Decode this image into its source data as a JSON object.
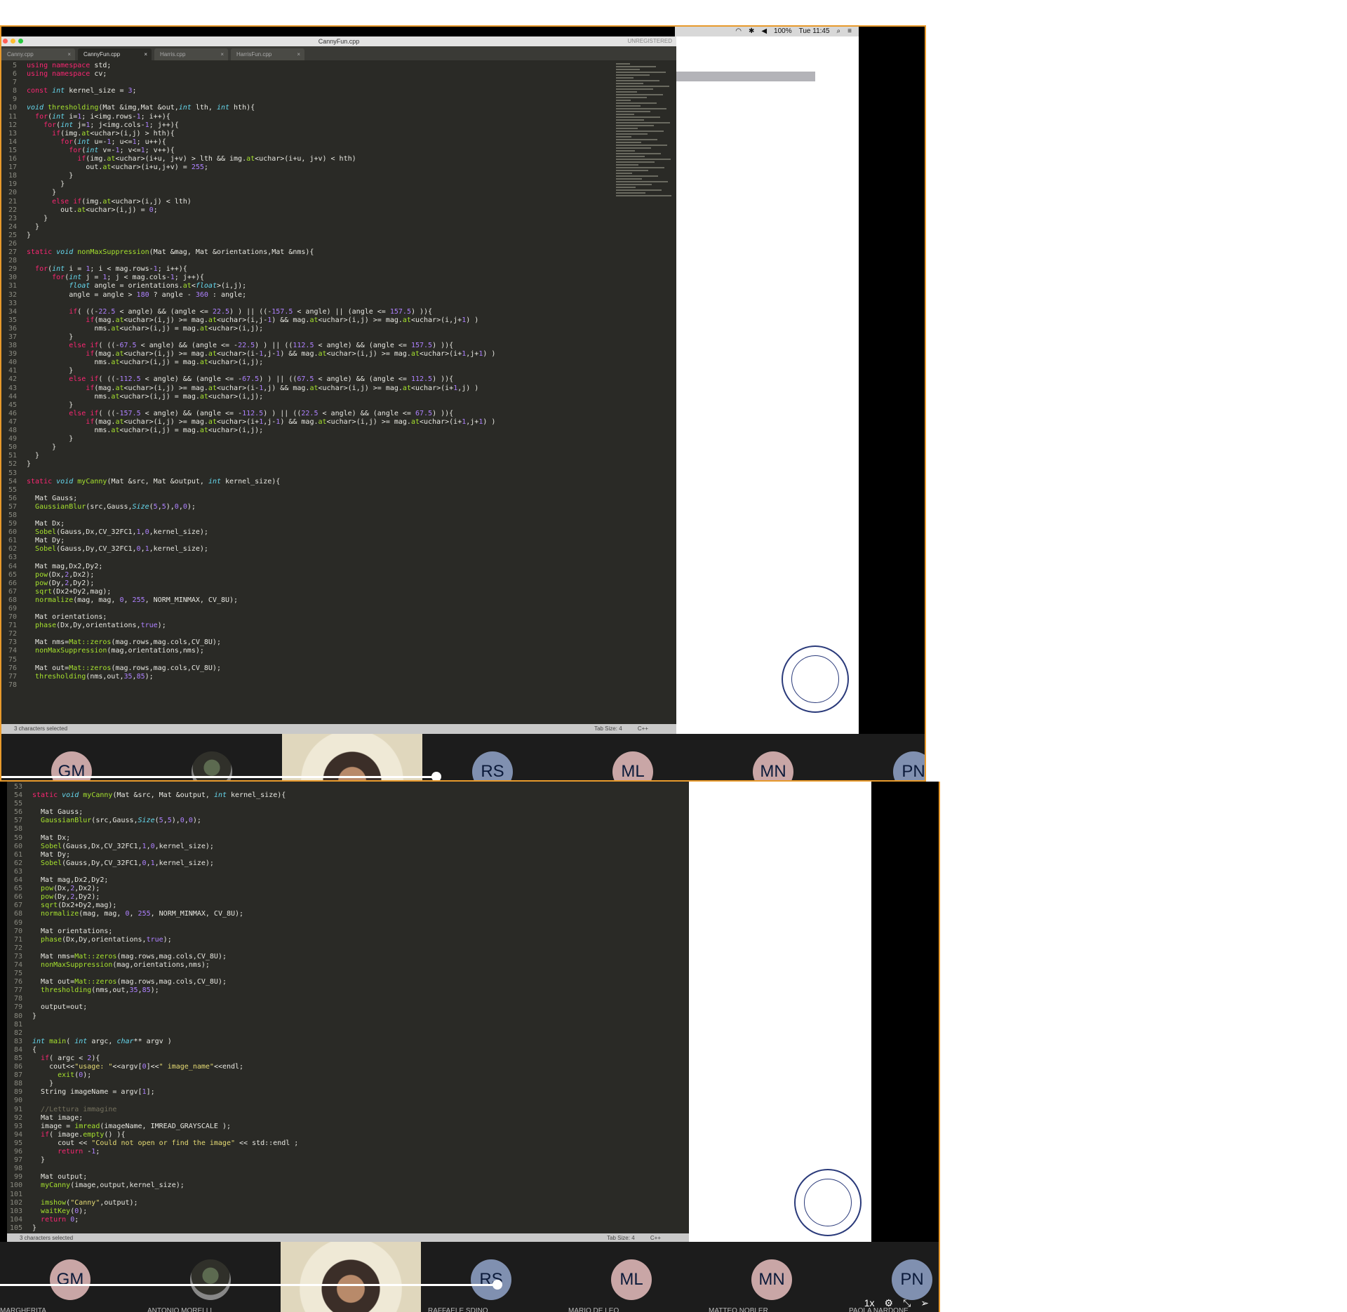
{
  "menubar": {
    "battery": "100%",
    "clock": "Tue 11:45"
  },
  "editor1": {
    "window_title": "CannyFun.cpp",
    "unregistered": "UNREGISTERED",
    "tabs": [
      {
        "label": "Canny.cpp",
        "active": false
      },
      {
        "label": "CannyFun.cpp",
        "active": true
      },
      {
        "label": "Harris.cpp",
        "active": false
      },
      {
        "label": "HarrisFun.cpp",
        "active": false
      }
    ],
    "status_left": "3 characters selected",
    "status_tab": "Tab Size: 4",
    "status_lang": "C++",
    "lines": [
      {
        "n": "5",
        "c": "<span class='kw'>using namespace</span> std;"
      },
      {
        "n": "6",
        "c": "<span class='kw'>using namespace</span> cv;"
      },
      {
        "n": "7",
        "c": ""
      },
      {
        "n": "8",
        "c": "<span class='kw'>const</span> <span class='ty'>int</span> kernel_size = <span class='nu'>3</span>;"
      },
      {
        "n": "9",
        "c": ""
      },
      {
        "n": "10",
        "c": "<span class='ty'>void</span> <span class='fn'>thresholding</span>(Mat &amp;img,Mat &amp;out,<span class='ty'>int</span> lth, <span class='ty'>int</span> hth){"
      },
      {
        "n": "11",
        "c": "  <span class='kw'>for</span>(<span class='ty'>int</span> i=<span class='nu'>1</span>; i&lt;img.rows-<span class='nu'>1</span>; i++){"
      },
      {
        "n": "12",
        "c": "    <span class='kw'>for</span>(<span class='ty'>int</span> j=<span class='nu'>1</span>; j&lt;img.cols-<span class='nu'>1</span>; j++){"
      },
      {
        "n": "13",
        "c": "      <span class='kw'>if</span>(img.<span class='fn'>at</span>&lt;uchar&gt;(i,j) &gt; hth){"
      },
      {
        "n": "14",
        "c": "        <span class='kw'>for</span>(<span class='ty'>int</span> u=-<span class='nu'>1</span>; u&lt;=<span class='nu'>1</span>; u++){"
      },
      {
        "n": "15",
        "c": "          <span class='kw'>for</span>(<span class='ty'>int</span> v=-<span class='nu'>1</span>; v&lt;=<span class='nu'>1</span>; v++){"
      },
      {
        "n": "16",
        "c": "            <span class='kw'>if</span>(img.<span class='fn'>at</span>&lt;uchar&gt;(i+u, j+v) &gt; lth &amp;&amp; img.<span class='fn'>at</span>&lt;uchar&gt;(i+u, j+v) &lt; hth)"
      },
      {
        "n": "17",
        "c": "              out.<span class='fn'>at</span>&lt;uchar&gt;(i+u,j+v) = <span class='nu'>255</span>;"
      },
      {
        "n": "18",
        "c": "          }"
      },
      {
        "n": "19",
        "c": "        }"
      },
      {
        "n": "20",
        "c": "      }"
      },
      {
        "n": "21",
        "c": "      <span class='kw'>else if</span>(img.<span class='fn'>at</span>&lt;uchar&gt;(i,j) &lt; lth)"
      },
      {
        "n": "22",
        "c": "        out.<span class='fn'>at</span>&lt;uchar&gt;(i,j) = <span class='nu'>0</span>;"
      },
      {
        "n": "23",
        "c": "    }"
      },
      {
        "n": "24",
        "c": "  }"
      },
      {
        "n": "25",
        "c": "}"
      },
      {
        "n": "26",
        "c": ""
      },
      {
        "n": "27",
        "c": "<span class='kw'>static</span> <span class='ty'>void</span> <span class='fn'>nonMaxSuppression</span>(Mat &amp;mag, Mat &amp;orientations,Mat &amp;nms){"
      },
      {
        "n": "28",
        "c": ""
      },
      {
        "n": "29",
        "c": "  <span class='kw'>for</span>(<span class='ty'>int</span> i = <span class='nu'>1</span>; i &lt; mag.rows-<span class='nu'>1</span>; i++){"
      },
      {
        "n": "30",
        "c": "      <span class='kw'>for</span>(<span class='ty'>int</span> j = <span class='nu'>1</span>; j &lt; mag.cols-<span class='nu'>1</span>; j++){"
      },
      {
        "n": "31",
        "c": "          <span class='ty'>float</span> angle = orientations.<span class='fn'>at</span>&lt;<span class='ty'>float</span>&gt;(i,j);"
      },
      {
        "n": "32",
        "c": "          angle = angle &gt; <span class='nu'>180</span> ? angle - <span class='nu'>360</span> : angle;"
      },
      {
        "n": "33",
        "c": ""
      },
      {
        "n": "34",
        "c": "          <span class='kw'>if</span>( ((-<span class='nu'>22.5</span> &lt; angle) &amp;&amp; (angle &lt;= <span class='nu'>22.5</span>) ) || ((-<span class='nu'>157.5</span> &lt; angle) || (angle &lt;= <span class='nu'>157.5</span>) )){"
      },
      {
        "n": "35",
        "c": "              <span class='kw'>if</span>(mag.<span class='fn'>at</span>&lt;uchar&gt;(i,j) &gt;= mag.<span class='fn'>at</span>&lt;uchar&gt;(i,j-<span class='nu'>1</span>) &amp;&amp; mag.<span class='fn'>at</span>&lt;uchar&gt;(i,j) &gt;= mag.<span class='fn'>at</span>&lt;uchar&gt;(i,j+<span class='nu'>1</span>) )"
      },
      {
        "n": "36",
        "c": "                nms.<span class='fn'>at</span>&lt;uchar&gt;(i,j) = mag.<span class='fn'>at</span>&lt;uchar&gt;(i,j);"
      },
      {
        "n": "37",
        "c": "          }"
      },
      {
        "n": "38",
        "c": "          <span class='kw'>else if</span>( ((-<span class='nu'>67.5</span> &lt; angle) &amp;&amp; (angle &lt;= -<span class='nu'>22.5</span>) ) || ((<span class='nu'>112.5</span> &lt; angle) &amp;&amp; (angle &lt;= <span class='nu'>157.5</span>) )){"
      },
      {
        "n": "39",
        "c": "              <span class='kw'>if</span>(mag.<span class='fn'>at</span>&lt;uchar&gt;(i,j) &gt;= mag.<span class='fn'>at</span>&lt;uchar&gt;(i-<span class='nu'>1</span>,j-<span class='nu'>1</span>) &amp;&amp; mag.<span class='fn'>at</span>&lt;uchar&gt;(i,j) &gt;= mag.<span class='fn'>at</span>&lt;uchar&gt;(i+<span class='nu'>1</span>,j+<span class='nu'>1</span>) )"
      },
      {
        "n": "40",
        "c": "                nms.<span class='fn'>at</span>&lt;uchar&gt;(i,j) = mag.<span class='fn'>at</span>&lt;uchar&gt;(i,j);"
      },
      {
        "n": "41",
        "c": "          }"
      },
      {
        "n": "42",
        "c": "          <span class='kw'>else if</span>( ((-<span class='nu'>112.5</span> &lt; angle) &amp;&amp; (angle &lt;= -<span class='nu'>67.5</span>) ) || ((<span class='nu'>67.5</span> &lt; angle) &amp;&amp; (angle &lt;= <span class='nu'>112.5</span>) )){"
      },
      {
        "n": "43",
        "c": "              <span class='kw'>if</span>(mag.<span class='fn'>at</span>&lt;uchar&gt;(i,j) &gt;= mag.<span class='fn'>at</span>&lt;uchar&gt;(i-<span class='nu'>1</span>,j) &amp;&amp; mag.<span class='fn'>at</span>&lt;uchar&gt;(i,j) &gt;= mag.<span class='fn'>at</span>&lt;uchar&gt;(i+<span class='nu'>1</span>,j) )"
      },
      {
        "n": "44",
        "c": "                nms.<span class='fn'>at</span>&lt;uchar&gt;(i,j) = mag.<span class='fn'>at</span>&lt;uchar&gt;(i,j);"
      },
      {
        "n": "45",
        "c": "          }"
      },
      {
        "n": "46",
        "c": "          <span class='kw'>else if</span>( ((-<span class='nu'>157.5</span> &lt; angle) &amp;&amp; (angle &lt;= -<span class='nu'>112.5</span>) ) || ((<span class='nu'>22.5</span> &lt; angle) &amp;&amp; (angle &lt;= <span class='nu'>67.5</span>) )){"
      },
      {
        "n": "47",
        "c": "              <span class='kw'>if</span>(mag.<span class='fn'>at</span>&lt;uchar&gt;(i,j) &gt;= mag.<span class='fn'>at</span>&lt;uchar&gt;(i+<span class='nu'>1</span>,j-<span class='nu'>1</span>) &amp;&amp; mag.<span class='fn'>at</span>&lt;uchar&gt;(i,j) &gt;= mag.<span class='fn'>at</span>&lt;uchar&gt;(i+<span class='nu'>1</span>,j+<span class='nu'>1</span>) )"
      },
      {
        "n": "48",
        "c": "                nms.<span class='fn'>at</span>&lt;uchar&gt;(i,j) = mag.<span class='fn'>at</span>&lt;uchar&gt;(i,j);"
      },
      {
        "n": "49",
        "c": "          }"
      },
      {
        "n": "50",
        "c": "      }"
      },
      {
        "n": "51",
        "c": "  }"
      },
      {
        "n": "52",
        "c": "}"
      },
      {
        "n": "53",
        "c": ""
      },
      {
        "n": "54",
        "c": "<span class='kw'>static</span> <span class='ty'>void</span> <span class='fn'>myCanny</span>(Mat &amp;src, Mat &amp;output, <span class='ty'>int</span> kernel_size){"
      },
      {
        "n": "55",
        "c": ""
      },
      {
        "n": "56",
        "c": "  Mat Gauss;"
      },
      {
        "n": "57",
        "c": "  <span class='fn'>GaussianBlur</span>(src,Gauss,<span class='ty'>Size</span>(<span class='nu'>5</span>,<span class='nu'>5</span>),<span class='nu'>0</span>,<span class='nu'>0</span>);"
      },
      {
        "n": "58",
        "c": ""
      },
      {
        "n": "59",
        "c": "  Mat Dx;"
      },
      {
        "n": "60",
        "c": "  <span class='fn'>Sobel</span>(Gauss,Dx,CV_32FC1,<span class='nu'>1</span>,<span class='nu'>0</span>,kernel_size);"
      },
      {
        "n": "61",
        "c": "  Mat Dy;"
      },
      {
        "n": "62",
        "c": "  <span class='fn'>Sobel</span>(Gauss,Dy,CV_32FC1,<span class='nu'>0</span>,<span class='nu'>1</span>,kernel_size);"
      },
      {
        "n": "63",
        "c": ""
      },
      {
        "n": "64",
        "c": "  Mat mag,Dx2,Dy2;"
      },
      {
        "n": "65",
        "c": "  <span class='fn'>pow</span>(Dx,<span class='nu'>2</span>,Dx2);"
      },
      {
        "n": "66",
        "c": "  <span class='fn'>pow</span>(Dy,<span class='nu'>2</span>,Dy2);"
      },
      {
        "n": "67",
        "c": "  <span class='fn'>sqrt</span>(Dx2+Dy2,mag);"
      },
      {
        "n": "68",
        "c": "  <span class='fn'>normalize</span>(mag, mag, <span class='nu'>0</span>, <span class='nu'>255</span>, NORM_MINMAX, CV_8U);"
      },
      {
        "n": "69",
        "c": ""
      },
      {
        "n": "70",
        "c": "  Mat orientations;"
      },
      {
        "n": "71",
        "c": "  <span class='fn'>phase</span>(Dx,Dy,orientations,<span class='nu'>true</span>);"
      },
      {
        "n": "72",
        "c": ""
      },
      {
        "n": "73",
        "c": "  Mat nms=<span class='fn'>Mat::zeros</span>(mag.rows,mag.cols,CV_8U);"
      },
      {
        "n": "74",
        "c": "  <span class='fn'>nonMaxSuppression</span>(mag,orientations,nms);"
      },
      {
        "n": "75",
        "c": ""
      },
      {
        "n": "76",
        "c": "  Mat out=<span class='fn'>Mat::zeros</span>(mag.rows,mag.cols,CV_8U);"
      },
      {
        "n": "77",
        "c": "  <span class='fn'>thresholding</span>(nms,out,<span class='nu'>35</span>,<span class='nu'>85</span>);"
      },
      {
        "n": "78",
        "c": ""
      }
    ]
  },
  "editor2": {
    "status_left": "3 characters selected",
    "status_tab": "Tab Size: 4",
    "status_lang": "C++",
    "lines": [
      {
        "n": "53",
        "c": ""
      },
      {
        "n": "54",
        "c": "<span class='kw'>static</span> <span class='ty'>void</span> <span class='fn'>myCanny</span>(Mat &amp;src, Mat &amp;output, <span class='ty'>int</span> kernel_size){"
      },
      {
        "n": "55",
        "c": ""
      },
      {
        "n": "56",
        "c": "  Mat Gauss;"
      },
      {
        "n": "57",
        "c": "  <span class='fn'>GaussianBlur</span>(src,Gauss,<span class='ty'>Size</span>(<span class='nu'>5</span>,<span class='nu'>5</span>),<span class='nu'>0</span>,<span class='nu'>0</span>);"
      },
      {
        "n": "58",
        "c": ""
      },
      {
        "n": "59",
        "c": "  Mat Dx;"
      },
      {
        "n": "60",
        "c": "  <span class='fn'>Sobel</span>(Gauss,Dx,CV_32FC1,<span class='nu'>1</span>,<span class='nu'>0</span>,kernel_size);"
      },
      {
        "n": "61",
        "c": "  Mat Dy;"
      },
      {
        "n": "62",
        "c": "  <span class='fn'>Sobel</span>(Gauss,Dy,CV_32FC1,<span class='nu'>0</span>,<span class='nu'>1</span>,kernel_size);"
      },
      {
        "n": "63",
        "c": ""
      },
      {
        "n": "64",
        "c": "  Mat mag,Dx2,Dy2;"
      },
      {
        "n": "65",
        "c": "  <span class='fn'>pow</span>(Dx,<span class='nu'>2</span>,Dx2);"
      },
      {
        "n": "66",
        "c": "  <span class='fn'>pow</span>(Dy,<span class='nu'>2</span>,Dy2);"
      },
      {
        "n": "67",
        "c": "  <span class='fn'>sqrt</span>(Dx2+Dy2,mag);"
      },
      {
        "n": "68",
        "c": "  <span class='fn'>normalize</span>(mag, mag, <span class='nu'>0</span>, <span class='nu'>255</span>, NORM_MINMAX, CV_8U);"
      },
      {
        "n": "69",
        "c": ""
      },
      {
        "n": "70",
        "c": "  Mat orientations;"
      },
      {
        "n": "71",
        "c": "  <span class='fn'>phase</span>(Dx,Dy,orientations,<span class='nu'>true</span>);"
      },
      {
        "n": "72",
        "c": ""
      },
      {
        "n": "73",
        "c": "  Mat nms=<span class='fn'>Mat::zeros</span>(mag.rows,mag.cols,CV_8U);"
      },
      {
        "n": "74",
        "c": "  <span class='fn'>nonMaxSuppression</span>(mag,orientations,nms);"
      },
      {
        "n": "75",
        "c": ""
      },
      {
        "n": "76",
        "c": "  Mat out=<span class='fn'>Mat::zeros</span>(mag.rows,mag.cols,CV_8U);"
      },
      {
        "n": "77",
        "c": "  <span class='fn'>thresholding</span>(nms,out,<span class='nu'>35</span>,<span class='nu'>85</span>);"
      },
      {
        "n": "78",
        "c": ""
      },
      {
        "n": "79",
        "c": "  output=out;"
      },
      {
        "n": "80",
        "c": "}"
      },
      {
        "n": "81",
        "c": ""
      },
      {
        "n": "82",
        "c": ""
      },
      {
        "n": "83",
        "c": "<span class='ty'>int</span> <span class='fn'>main</span>( <span class='ty'>int</span> argc, <span class='ty'>char</span>** argv )"
      },
      {
        "n": "84",
        "c": "{"
      },
      {
        "n": "85",
        "c": "  <span class='kw'>if</span>( argc &lt; <span class='nu'>2</span>){"
      },
      {
        "n": "86",
        "c": "    cout&lt;&lt;<span class='st'>\"usage: \"</span>&lt;&lt;argv[<span class='nu'>0</span>]&lt;&lt;<span class='st'>\" image_name\"</span>&lt;&lt;endl;"
      },
      {
        "n": "87",
        "c": "      <span class='fn'>exit</span>(<span class='nu'>0</span>);"
      },
      {
        "n": "88",
        "c": "    }"
      },
      {
        "n": "89",
        "c": "  String imageName = argv[<span class='nu'>1</span>];"
      },
      {
        "n": "90",
        "c": ""
      },
      {
        "n": "91",
        "c": "  <span class='cm'>//Lettura immagine</span>"
      },
      {
        "n": "92",
        "c": "  Mat image;"
      },
      {
        "n": "93",
        "c": "  image = <span class='fn'>imread</span>(imageName, IMREAD_GRAYSCALE );"
      },
      {
        "n": "94",
        "c": "  <span class='kw'>if</span>( image.<span class='fn'>empty</span>() ){"
      },
      {
        "n": "95",
        "c": "      cout &lt;&lt; <span class='st'>\"Could not open or find the image\"</span> &lt;&lt; std::endl ;"
      },
      {
        "n": "96",
        "c": "      <span class='kw'>return</span> -<span class='nu'>1</span>;"
      },
      {
        "n": "97",
        "c": "  }"
      },
      {
        "n": "98",
        "c": ""
      },
      {
        "n": "99",
        "c": "  Mat output;"
      },
      {
        "n": "100",
        "c": "  <span class='fn'>myCanny</span>(image,output,kernel_size);"
      },
      {
        "n": "101",
        "c": ""
      },
      {
        "n": "102",
        "c": "  <span class='fn'>imshow</span>(<span class='st'>\"Canny\"</span>,output);"
      },
      {
        "n": "103",
        "c": "  <span class='fn'>waitKey</span>(<span class='nu'>0</span>);"
      },
      {
        "n": "104",
        "c": "  <span class='kw'>return</span> <span class='nu'>0</span>;"
      },
      {
        "n": "105",
        "c": "}"
      }
    ]
  },
  "participants": [
    {
      "initials": "GM",
      "name": "RGHERITA",
      "color": "#c9a6a6",
      "kind": "avatar"
    },
    {
      "initials": "",
      "name": "ANTONIO MORELLI",
      "color": "#555555",
      "kind": "photo2"
    },
    {
      "initials": "",
      "name": "",
      "color": "#e9e4d4",
      "kind": "speaker"
    },
    {
      "initials": "RS",
      "name": "RAFFAELE SDINO",
      "color": "#8090b0",
      "kind": "avatar"
    },
    {
      "initials": "ML",
      "name": "MARIO DE LEO",
      "color": "#c9a6a6",
      "kind": "avatar"
    },
    {
      "initials": "MN",
      "name": "MATTEO NOBLER",
      "color": "#c9a6a6",
      "kind": "avatar"
    },
    {
      "initials": "PN",
      "name": "PAOLA NARDONE",
      "color": "#8090b0",
      "kind": "avatar"
    }
  ],
  "participants2_first_name": "MARGHERITA",
  "player": {
    "speed": "1x",
    "progress1": 0.47,
    "progress2": 0.53
  }
}
